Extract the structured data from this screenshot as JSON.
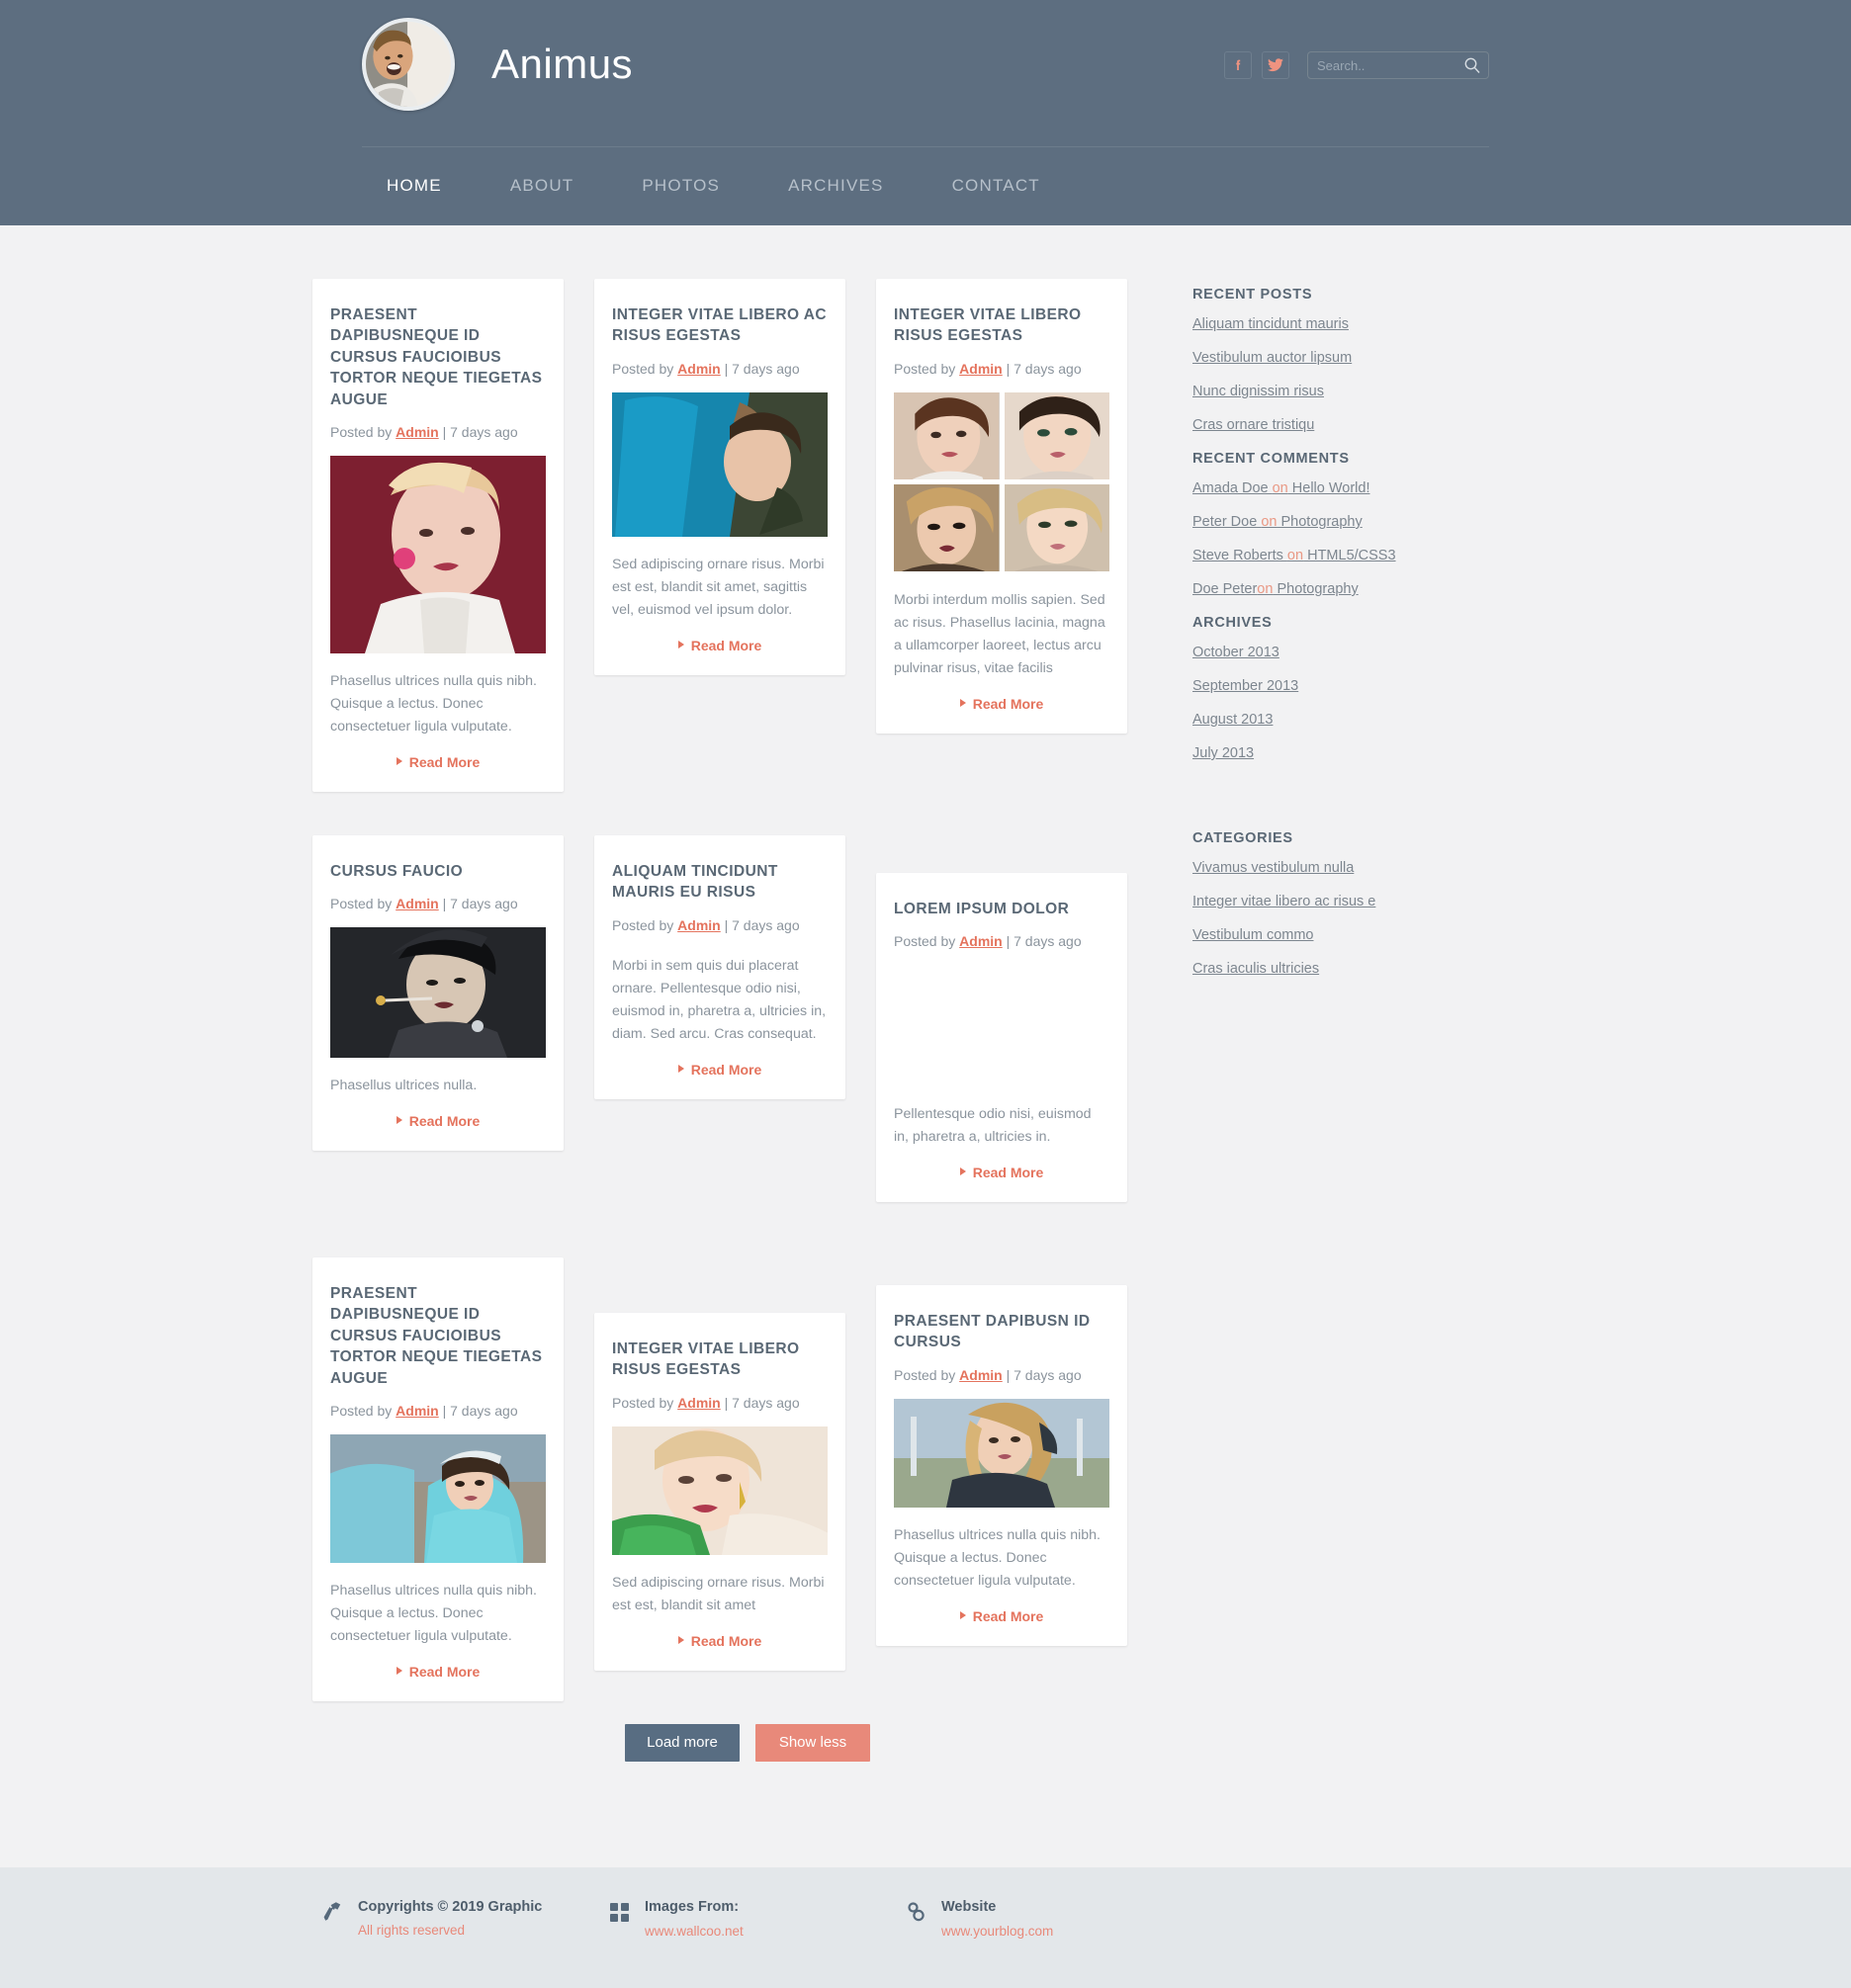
{
  "header": {
    "brand_title": "Animus",
    "avatar_alt": "avatar-portrait",
    "social": [
      {
        "name": "facebook-icon",
        "label": "f"
      },
      {
        "name": "twitter-icon",
        "label": "t"
      }
    ],
    "search": {
      "placeholder": "Search..",
      "value": ""
    }
  },
  "nav": {
    "items": [
      {
        "label": "HOME",
        "active": true
      },
      {
        "label": "ABOUT",
        "active": false
      },
      {
        "label": "PHOTOS",
        "active": false
      },
      {
        "label": "ARCHIVES",
        "active": false
      },
      {
        "label": "CONTACT",
        "active": false
      }
    ]
  },
  "posts": [
    {
      "title": "PRAESENT DAPIBUSNEQUE ID CURSUS FAUCIOIBUS TORTOR NEQUE TIEGETAS AUGUE",
      "posted_by_label": "Posted by",
      "author": "Admin",
      "date": "| 7 days ago",
      "excerpt": "Phasellus ultrices nulla quis nibh. Quisque a lectus. Donec consectetuer ligula vulputate.",
      "read_more": "Read More"
    },
    {
      "title": "INTEGER VITAE LIBERO AC RISUS EGESTAS",
      "posted_by_label": "Posted by",
      "author": "Admin",
      "date": "| 7 days ago",
      "excerpt": "Sed adipiscing ornare risus. Morbi est est, blandit sit amet, sagittis vel, euismod vel ipsum dolor.",
      "read_more": "Read More"
    },
    {
      "title": "INTEGER VITAE LIBERO RISUS EGESTAS",
      "posted_by_label": "Posted by",
      "author": "Admin",
      "date": "| 7 days ago",
      "excerpt": "Morbi interdum mollis sapien. Sed ac risus. Phasellus lacinia, magna a ullamcorper laoreet, lectus arcu pulvinar risus, vitae facilis",
      "read_more": "Read More"
    },
    {
      "title": "CURSUS FAUCIO",
      "posted_by_label": "Posted by",
      "author": "Admin",
      "date": "| 7 days ago",
      "excerpt": "Phasellus ultrices nulla.",
      "read_more": "Read More"
    },
    {
      "title": "ALIQUAM TINCIDUNT MAURIS EU RISUS",
      "posted_by_label": "Posted by",
      "author": "Admin",
      "date": "| 7 days ago",
      "excerpt": "Morbi in sem quis dui placerat ornare. Pellentesque odio nisi, euismod in, pharetra a, ultricies in, diam. Sed arcu. Cras consequat.",
      "read_more": "Read More"
    },
    {
      "title": "LOREM IPSUM DOLOR",
      "posted_by_label": "Posted by",
      "author": "Admin",
      "date": "| 7 days ago",
      "excerpt": "Pellentesque odio nisi, euismod in, pharetra a, ultricies in.",
      "read_more": "Read More"
    },
    {
      "title": "PRAESENT DAPIBUSNEQUE ID CURSUS FAUCIOIBUS TORTOR NEQUE TIEGETAS AUGUE",
      "posted_by_label": "Posted by",
      "author": "Admin",
      "date": "| 7 days ago",
      "excerpt": "Phasellus ultrices nulla quis nibh. Quisque a lectus. Donec consectetuer ligula vulputate.",
      "read_more": "Read More"
    },
    {
      "title": "INTEGER VITAE LIBERO RISUS EGESTAS",
      "posted_by_label": "Posted by",
      "author": "Admin",
      "date": "| 7 days ago",
      "excerpt": "Sed adipiscing ornare risus. Morbi est est, blandit sit amet",
      "read_more": "Read More"
    },
    {
      "title": "PRAESENT DAPIBUSN ID CURSUS",
      "posted_by_label": "Posted by",
      "author": "Admin",
      "date": "| 7 days ago",
      "excerpt": "Phasellus ultrices nulla quis nibh. Quisque a lectus. Donec consectetuer ligula vulputate.",
      "read_more": "Read More"
    }
  ],
  "sidebar": {
    "recent_posts_title": "RECENT POSTS",
    "recent_posts": [
      "Aliquam tincidunt mauris",
      "Vestibulum auctor lipsum",
      "Nunc dignissim risus",
      "Cras ornare tristiqu"
    ],
    "recent_comments_title": "RECENT COMMENTS",
    "recent_comments": [
      {
        "who": "Amada Doe ",
        "on": "on",
        "what": " Hello World!"
      },
      {
        "who": "Peter Doe ",
        "on": "on",
        "what": " Photography"
      },
      {
        "who": "Steve Roberts ",
        "on": "on",
        "what": " HTML5/CSS3"
      },
      {
        "who": "Doe Peter",
        "on": "on",
        "what": " Photography"
      }
    ],
    "archives_title": "ARCHIVES",
    "archives": [
      "October 2013",
      "September 2013",
      "August 2013",
      "July 2013"
    ],
    "categories_title": "CATEGORIES",
    "categories": [
      "Vivamus vestibulum nulla",
      "Integer vitae libero ac risus e",
      "Vestibulum commo",
      "Cras iaculis ultricies"
    ]
  },
  "buttons": {
    "load_more": "Load more",
    "show_less": "Show less"
  },
  "footer": {
    "columns": [
      {
        "icon": "hammer-icon",
        "main": "Copyrights © 2019 Graphic",
        "sub": "All rights reserved"
      },
      {
        "icon": "grid-icon",
        "main": "Images From:",
        "sub": "www.wallcoo.net"
      },
      {
        "icon": "link-icon",
        "main": "Website",
        "sub": "www.yourblog.com"
      }
    ]
  },
  "colors": {
    "header_bg": "#5d6e80",
    "accent": "#e4735d",
    "heading": "#5a6875",
    "body_text": "#8b949d",
    "page_bg": "#f2f2f3",
    "footer_bg": "#e3e7ea",
    "btn_load": "#586d82",
    "btn_less": "#e8897a"
  }
}
